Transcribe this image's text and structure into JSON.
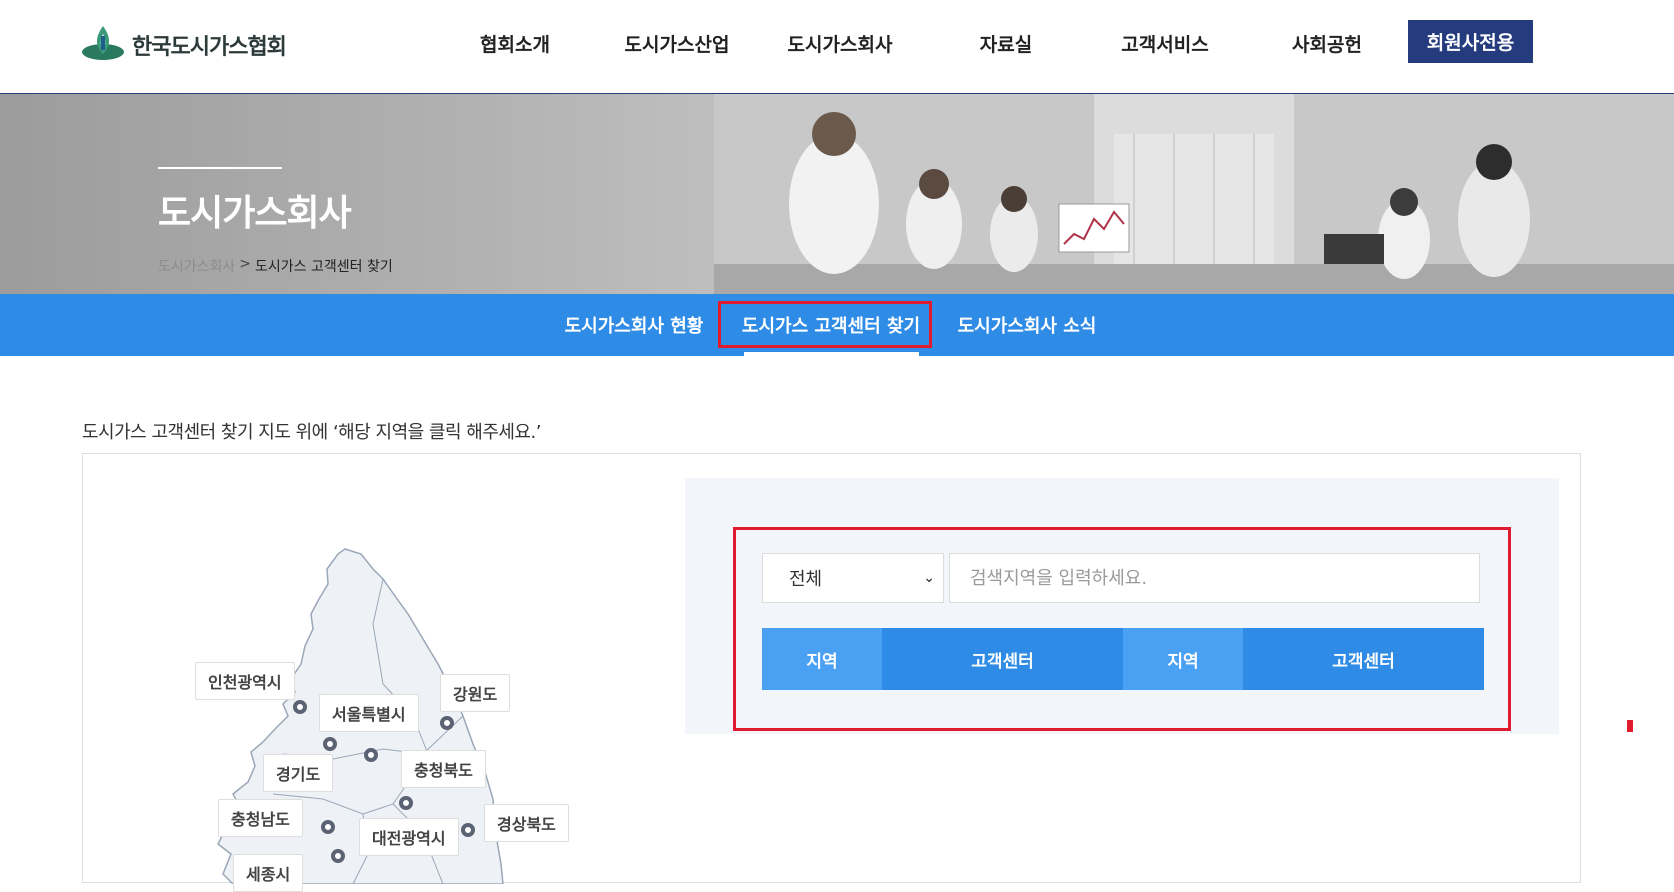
{
  "header": {
    "logo_text": "한국도시가스협회",
    "nav": [
      "협회소개",
      "도시가스산업",
      "도시가스회사",
      "자료실",
      "고객서비스",
      "사회공헌"
    ],
    "member_button": "회원사전용"
  },
  "banner": {
    "title": "도시가스회사",
    "breadcrumb": [
      "도시가스회사",
      ">",
      "도시가스 고객센터 찾기"
    ]
  },
  "subnav": {
    "items": [
      "도시가스회사 현황",
      "도시가스 고객센터 찾기",
      "도시가스회사 소식"
    ],
    "active_index": 1
  },
  "content": {
    "intro": "도시가스 고객센터 찾기 지도 위에 ‘해당 지역을 클릭 해주세요.’",
    "map_labels": [
      "인천광역시",
      "서울특별시",
      "강원도",
      "경기도",
      "충청북도",
      "충청남도",
      "경상북도",
      "대전광역시",
      "세종시"
    ],
    "search": {
      "select_value": "전체",
      "input_placeholder": "검색지역을 입력하세요.",
      "input_value": ""
    },
    "table_headers": [
      "지역",
      "고객센터",
      "지역",
      "고객센터"
    ]
  },
  "colors": {
    "primary_blue": "#2f8ce6",
    "light_blue": "#4aa0f2",
    "navy": "#243c7e",
    "highlight_red": "#e01b2e"
  }
}
